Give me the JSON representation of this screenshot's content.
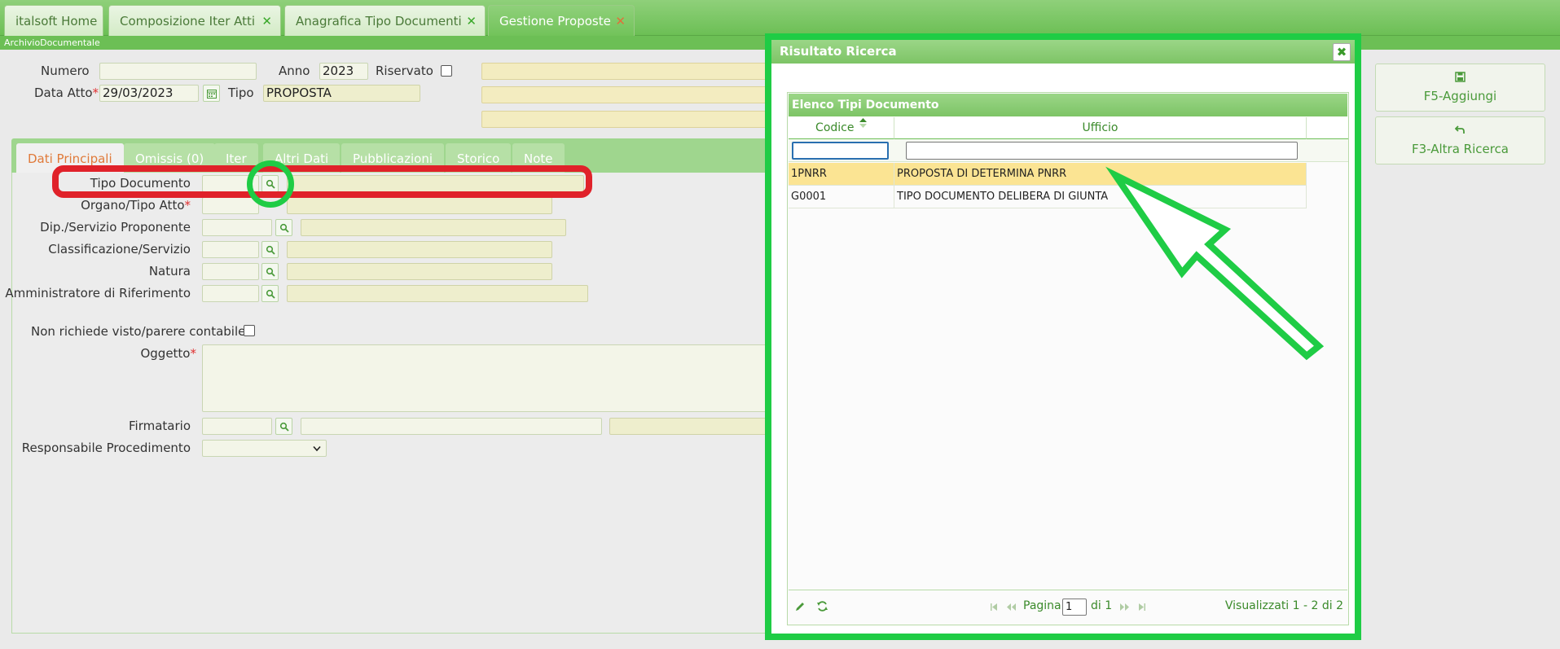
{
  "tabs": [
    {
      "label": "italsoft Home",
      "closable": false,
      "active": false
    },
    {
      "label": "Composizione Iter Atti",
      "closable": true,
      "active": false
    },
    {
      "label": "Anagrafica Tipo Documenti",
      "closable": true,
      "active": false
    },
    {
      "label": "Gestione Proposte",
      "closable": true,
      "active": true
    }
  ],
  "close_glyph": "✕",
  "breadcrumb": "ArchivioDocumentale",
  "header_fields": {
    "numero_label": "Numero",
    "numero_value": "",
    "anno_label": "Anno",
    "anno_value": "2023",
    "riservato_label": "Riservato",
    "data_atto_label": "Data Atto",
    "data_atto_value": "29/03/2023",
    "tipo_label": "Tipo",
    "tipo_value": "PROPOSTA",
    "required_mark": "*"
  },
  "form_tabs": [
    {
      "label": "Dati Principali",
      "active": true
    },
    {
      "label": "Omissis (0)",
      "active": false
    },
    {
      "label": "Iter",
      "active": false
    },
    {
      "label": "Altri Dati",
      "active": false
    },
    {
      "label": "Pubblicazioni",
      "active": false
    },
    {
      "label": "Storico",
      "active": false
    },
    {
      "label": "Note",
      "active": false
    }
  ],
  "fields": {
    "tipo_documento": "Tipo Documento",
    "organo_tipo_atto": "Organo/Tipo Atto",
    "dip_servizio": "Dip./Servizio Proponente",
    "classificazione": "Classificazione/Servizio",
    "natura": "Natura",
    "amministratore": "Amministratore di Riferimento",
    "non_richiede": "Non richiede visto/parere contabile",
    "oggetto": "Oggetto",
    "firmatario": "Firmatario",
    "responsabile": "Responsabile Procedimento"
  },
  "modal": {
    "title": "Risultato Ricerca",
    "close_glyph": "✖",
    "grid_title": "Elenco Tipi Documento",
    "columns": [
      "Codice",
      "Ufficio"
    ],
    "rows": [
      {
        "codice": "1PNRR",
        "ufficio": "PROPOSTA DI DETERMINA PNRR",
        "selected": true
      },
      {
        "codice": "G0001",
        "ufficio": "TIPO DOCUMENTO DELIBERA DI GIUNTA",
        "selected": false
      }
    ],
    "pager": {
      "page_label": "Pagina",
      "page_value": "1",
      "of_label": "di 1",
      "summary": "Visualizzati 1 - 2 di 2"
    }
  },
  "right_buttons": [
    {
      "label": "F5-Aggiungi",
      "icon": "save-icon"
    },
    {
      "label": "F3-Altra Ricerca",
      "icon": "undo-icon"
    }
  ],
  "colors": {
    "accent_green": "#6cbf55",
    "annotation_green": "#1fcc45",
    "annotation_red": "#e0222a",
    "selected_row": "#fbe493"
  }
}
